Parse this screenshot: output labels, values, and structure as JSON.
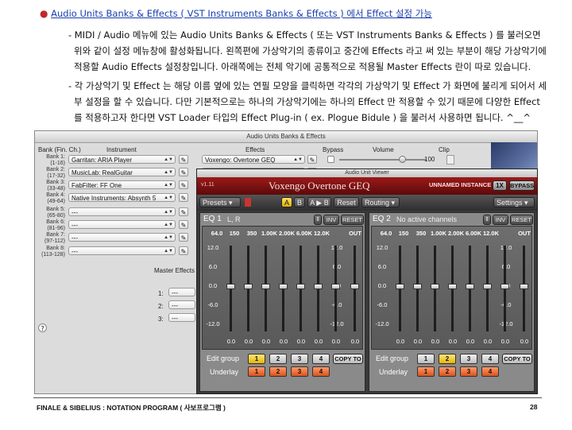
{
  "doc": {
    "bullet_title": "Audio Units Banks & Effects ( VST Instruments Banks & Effects ) 에서 Effect 설정 가능",
    "para1_line1": "- MIDI / Audio 메뉴에 있는 Audio Units Banks & Effects ( 또는 VST Instruments Banks & Effects ) 를 불러오면",
    "para1_line2": "위와 같이 설정 메뉴창에 활성화됩니다. 왼쪽편에 가상악기의 종류이고 중간에 Effects 라고 써 있는 부분이 해당 가상악기에",
    "para1_line3": "적용할 Audio Effects 설정창입니다. 아래쪽에는 전체 악기에 공통적으로 적용될 Master Effects 란이 따로 있습니다.",
    "para2_line1": "- 각 가상악기 및 Effect 는 해당 이름 옆에 있는 연필 모양을 클릭하면 각각의 가상악기 및 Effect 가 화면에 불리게 되어서 세",
    "para2_line2": "부 설정을 할 수 있습니다. 다만 기본적으로는 하나의 가상악기에는 하나의 Effect 만 적용할 수 있기 때문에 다양한 Effect",
    "para2_line3": "를 적용하고자 한다면 VST Loader 타입의 Effect Plug-in ( ex. Plogue Bidule ) 을 불러서 사용하면 됩니다. ^__^"
  },
  "window": {
    "title": "Audio Units Banks & Effects",
    "col_bank": "Bank (Fin. Ch.)",
    "col_instrument": "Instrument",
    "col_effects": "Effects",
    "col_bypass": "Bypass",
    "col_volume": "Volume",
    "col_clip": "Clip",
    "volume_value": "100",
    "banks": [
      {
        "name": "Bank 1:",
        "range": "(1-16)",
        "instrument": "Garritan: ARIA Player"
      },
      {
        "name": "Bank 2:",
        "range": "(17-32)",
        "instrument": "MusicLab: RealGuitar"
      },
      {
        "name": "Bank 3:",
        "range": "(33-48)",
        "instrument": "FabFilter: FF One"
      },
      {
        "name": "Bank 4:",
        "range": "(49-64)",
        "instrument": "Native Instruments: Absynth 5"
      },
      {
        "name": "Bank 5:",
        "range": "(65-80)",
        "instrument": "---"
      },
      {
        "name": "Bank 6:",
        "range": "(81-96)",
        "instrument": "---"
      },
      {
        "name": "Bank 7:",
        "range": "(97-112)",
        "instrument": "---"
      },
      {
        "name": "Bank 8:",
        "range": "(113-128)",
        "instrument": "---"
      }
    ],
    "effect1": "Voxengo: Overtone GEQ",
    "effect2": "---",
    "master_label": "Master Effects",
    "master_rows": [
      {
        "num": "1:",
        "value": "---"
      },
      {
        "num": "2:",
        "value": "---"
      },
      {
        "num": "3:",
        "value": "---"
      }
    ],
    "help": "?"
  },
  "plugin": {
    "window_title": "Audio Unit Viewer",
    "version": "v1.11",
    "name": "Voxengo Overtone GEQ",
    "instance": "UNNAMED INSTANCE",
    "btn_1x": "1X",
    "btn_bypass": "BYPASS",
    "presets": "Presets",
    "btn_a": "A",
    "btn_b": "B",
    "btn_ab": "A ▶ B",
    "btn_reset": "Reset",
    "routing": "Routing",
    "settings": "Settings",
    "eq1": {
      "label": "EQ 1",
      "channels": "L, R",
      "inv": "INV",
      "reset": "RESET",
      "group_selected": 1,
      "underlay_selected": 0
    },
    "eq2": {
      "label": "EQ 2",
      "channels": "No active channels",
      "inv": "INV",
      "reset": "RESET",
      "group_selected": 2,
      "underlay_selected": 0
    },
    "freqs": [
      "64.0",
      "150",
      "350",
      "1.00K",
      "2.00K",
      "6.00K",
      "12.0K",
      "OUT"
    ],
    "db_scale": [
      "12.0",
      "6.0",
      "0.0",
      "-6.0",
      "-12.0"
    ],
    "slider_values": [
      "0.0",
      "0.0",
      "0.0",
      "0.0",
      "0.0",
      "0.0",
      "0.0",
      "0.0"
    ],
    "edit_group": "Edit group",
    "underlay": "Underlay",
    "group_nums": [
      "1",
      "2",
      "3",
      "4"
    ],
    "copy_to": "COPY TO"
  },
  "footer": {
    "left": "FINALE & SIBELIUS : NOTATION PROGRAM ( 사보프로그램 )",
    "page": "28"
  },
  "colors": {
    "link": "#1a3fae",
    "bullet": "#c0282d",
    "plugin_red": "#9c1a1a",
    "group_yellow": "#e8b800",
    "underlay_orange": "#d9531e"
  }
}
